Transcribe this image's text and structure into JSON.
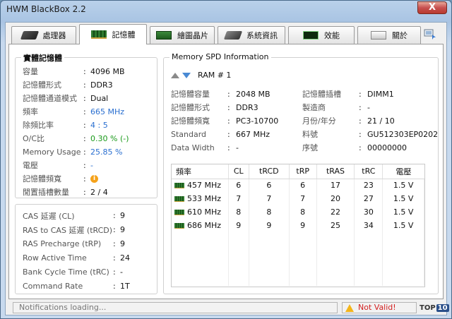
{
  "window": {
    "title": "HWM BlackBox 2.2",
    "close_label": "X"
  },
  "tabs": [
    {
      "label": "處理器",
      "icon": "cpu-icon"
    },
    {
      "label": "記憶體",
      "icon": "ram-icon"
    },
    {
      "label": "繪圖晶片",
      "icon": "gpu-icon"
    },
    {
      "label": "系統資訊",
      "icon": "system-icon"
    },
    {
      "label": "效能",
      "icon": "performance-icon"
    },
    {
      "label": "關於",
      "icon": "about-icon"
    }
  ],
  "physical_memory": {
    "title": "實體記憶體",
    "rows": [
      {
        "label": "容量",
        "value": "4096 MB"
      },
      {
        "label": "記憶體形式",
        "value": "DDR3"
      },
      {
        "label": "記憶體通道模式",
        "value": "Dual"
      },
      {
        "label": "頻率",
        "value": "665 MHz"
      },
      {
        "label": "除頻比率",
        "value": "4 : 5"
      },
      {
        "label": "O/C比",
        "value": "0.30 % (-)"
      },
      {
        "label": "Memory Usage",
        "value": "25.85 %"
      },
      {
        "label": "電壓",
        "value": "-"
      },
      {
        "label": "記憶體頻寬",
        "value": "i"
      },
      {
        "label": "閒置插槽數量",
        "value": "2  /  4"
      }
    ]
  },
  "timings": {
    "rows": [
      {
        "label": "CAS 延遲 (CL)",
        "value": "9"
      },
      {
        "label": "RAS to CAS 延遲 (tRCD)",
        "value": "9"
      },
      {
        "label": "RAS Precharge (tRP)",
        "value": "9"
      },
      {
        "label": "Row Active Time",
        "value": "24"
      },
      {
        "label": "Bank Cycle Time (tRC)",
        "value": "-"
      },
      {
        "label": "Command Rate",
        "value": "1T"
      }
    ]
  },
  "spd": {
    "title": "Memory SPD Information",
    "ram_label": "RAM # 1",
    "left_rows": [
      {
        "label": "記憶體容量",
        "value": "2048 MB"
      },
      {
        "label": "記憶體形式",
        "value": "DDR3"
      },
      {
        "label": "記憶體頻寬",
        "value": "PC3-10700"
      },
      {
        "label": "Standard",
        "value": "667 MHz"
      },
      {
        "label": "Data Width",
        "value": "-"
      }
    ],
    "right_rows": [
      {
        "label": "記憶體插槽",
        "value": "DIMM1"
      },
      {
        "label": "製造商",
        "value": "-"
      },
      {
        "label": "月份/年分",
        "value": "21 / 10"
      },
      {
        "label": "料號",
        "value": "GU512303EP0202"
      },
      {
        "label": "序號",
        "value": "00000000"
      }
    ],
    "table": {
      "headers": [
        "頻率",
        "CL",
        "tRCD",
        "tRP",
        "tRAS",
        "tRC",
        "電壓"
      ],
      "rows": [
        [
          "457 MHz",
          "6",
          "6",
          "6",
          "17",
          "23",
          "1.5 V"
        ],
        [
          "533 MHz",
          "7",
          "7",
          "7",
          "20",
          "27",
          "1.5 V"
        ],
        [
          "610 MHz",
          "8",
          "8",
          "8",
          "22",
          "30",
          "1.5 V"
        ],
        [
          "686 MHz",
          "9",
          "9",
          "9",
          "25",
          "34",
          "1.5 V"
        ]
      ]
    }
  },
  "status": {
    "notifications": "Notifications loading...",
    "validity": "Not Valid!",
    "top_brand": "TOP",
    "top_num": "10"
  },
  "colors": {
    "accent_blue": "#2a6fd0",
    "ok_green": "#1a9a1a",
    "error_red": "#d21f1f"
  }
}
